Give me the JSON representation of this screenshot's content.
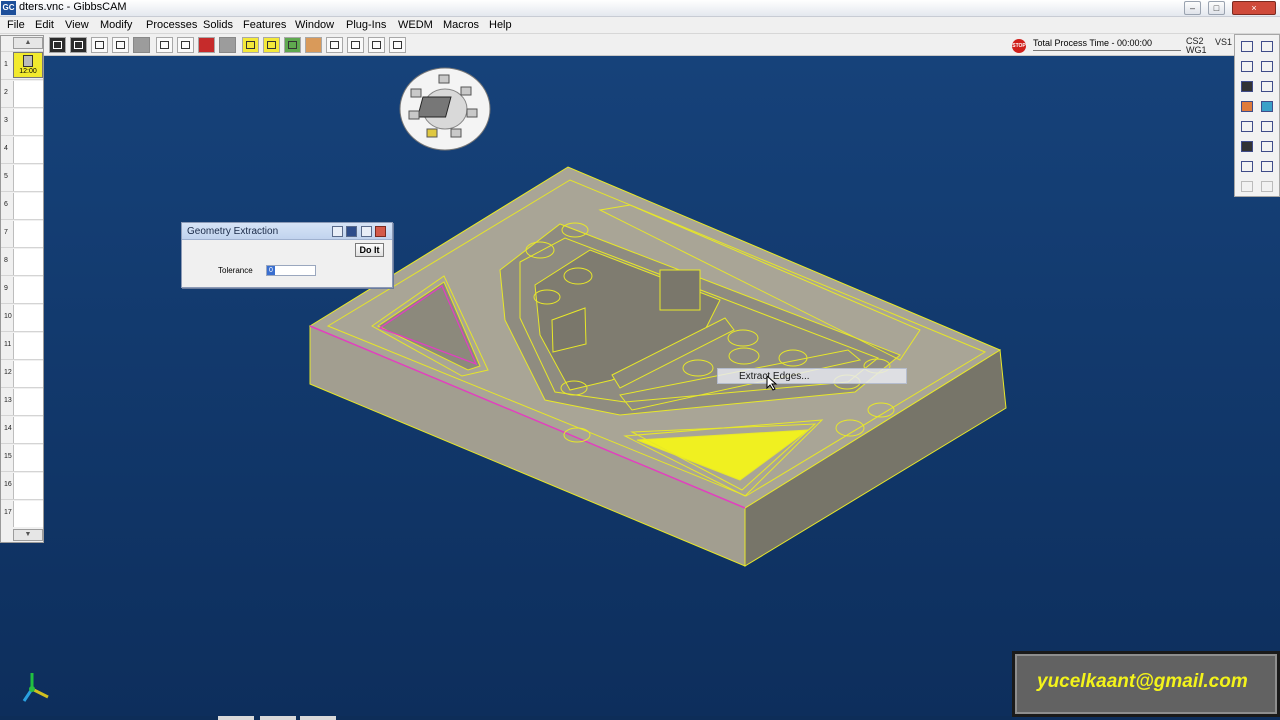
{
  "window": {
    "title": "dters.vnc - GibbsCAM",
    "app_badge": "GC",
    "minimize": "–",
    "maximize": "□",
    "close": "×"
  },
  "menu": [
    "File",
    "Edit",
    "View",
    "Modify",
    "Processes",
    "Solids",
    "Features",
    "Window",
    "Plug-Ins",
    "WEDM",
    "Macros",
    "Help"
  ],
  "status": {
    "stop_icon": "STOP",
    "process_time": "Total Process Time - 00:00:00",
    "cs": "CS2",
    "wg": "WG1",
    "vs": "VS1"
  },
  "left_panel": {
    "scroll_up": "▲",
    "scroll_down": "▼",
    "operation_time": "12:00",
    "row_numbers": [
      "1",
      "2",
      "3",
      "4",
      "5",
      "6",
      "7",
      "8",
      "9",
      "10",
      "11",
      "12",
      "13",
      "14",
      "15",
      "16",
      "17"
    ]
  },
  "dialog": {
    "title": "Geometry Extraction",
    "do_it": "Do It",
    "tolerance_label": "Tolerance",
    "tolerance_value": "0"
  },
  "context_menu": {
    "item": "Extract Edges..."
  },
  "watermark": {
    "text": "yucelkaant@gmail.com"
  },
  "colors": {
    "viewport_bg": "#103668",
    "edge_highlight": "#f0f020",
    "selection": "#e040c0",
    "face_fill": "#a6a294",
    "watermark_text": "#f3f31b"
  }
}
